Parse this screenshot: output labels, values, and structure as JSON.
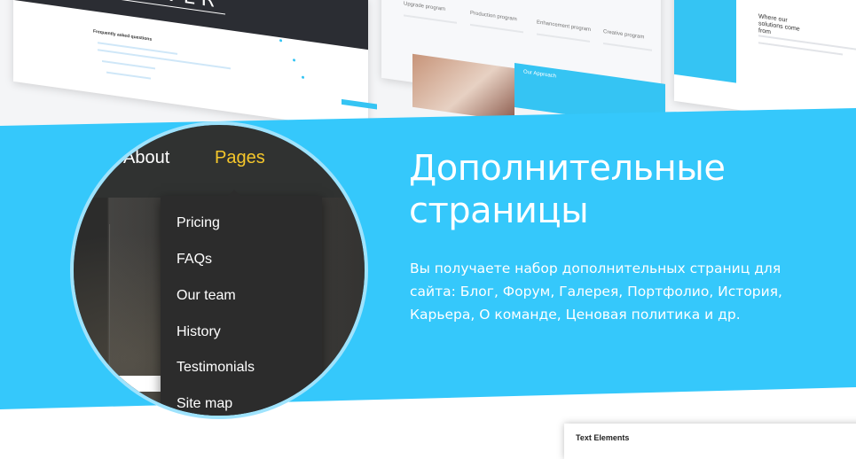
{
  "thumbnails": {
    "logo_text": "CLEVER",
    "faq_title": "Frequently asked questions",
    "columns": [
      "Upgrade program",
      "Production program",
      "Enhancement program",
      "Creative program"
    ],
    "approach_label": "Our Approach",
    "where_title": "Where our solutions come from"
  },
  "magnifier": {
    "nav": {
      "about": "About",
      "pages": "Pages"
    },
    "dropdown_items": [
      "Pricing",
      "FAQs",
      "Our team",
      "History",
      "Testimonials",
      "Site map"
    ]
  },
  "feature": {
    "heading": "Дополнительные страницы",
    "description": "Вы получаете набор дополнительных страниц для сайта: Блог, Форум, Галерея, Портфолио, История, Карьера, О команде, Ценовая политика и др."
  },
  "card": {
    "title": "Text Elements"
  },
  "colors": {
    "accent_blue": "#35c8fb",
    "highlight_yellow": "#f5c72b",
    "dark_menu": "#2c2c2c"
  }
}
